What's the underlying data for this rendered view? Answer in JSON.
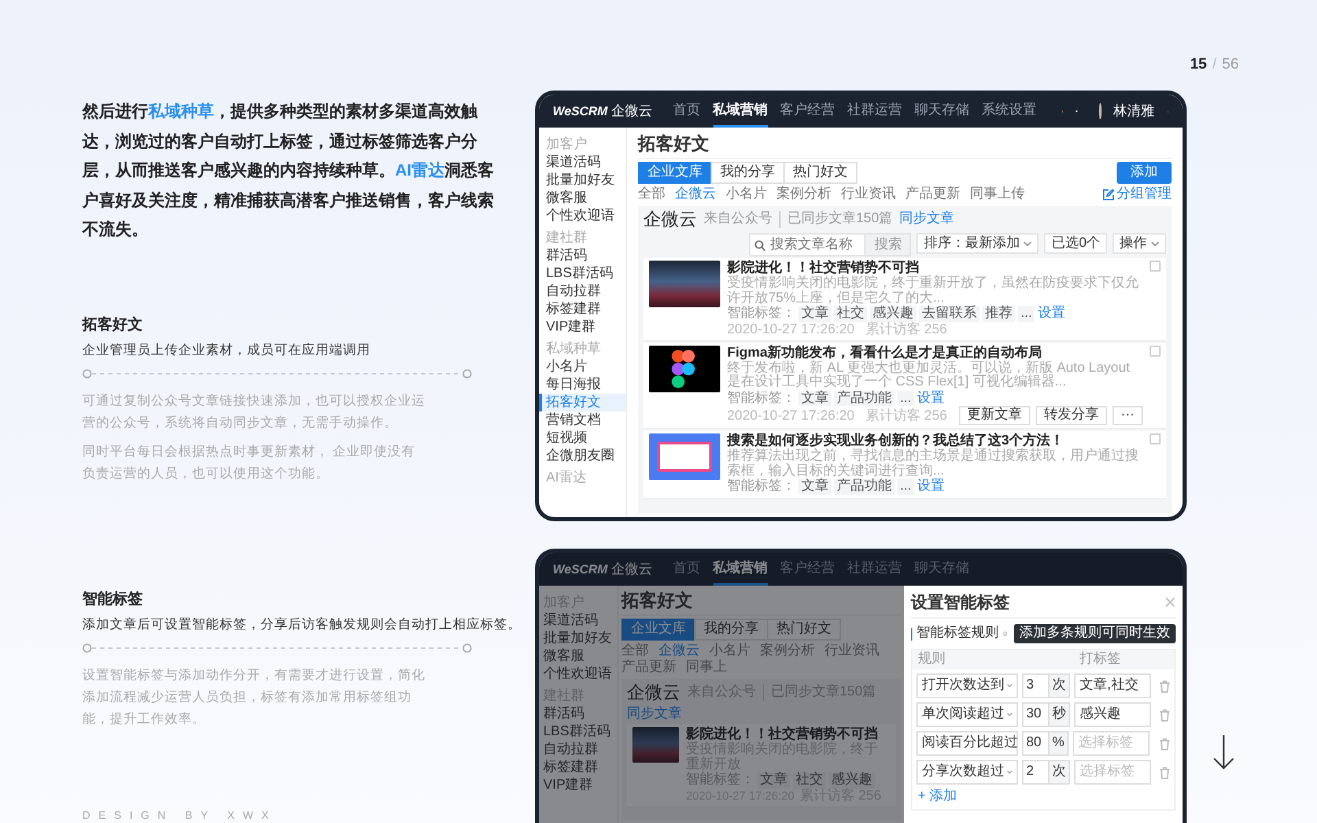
{
  "page_indicator": {
    "current": "15",
    "separator": "/",
    "total": "56"
  },
  "intro": "然后进行**私域种草**，提供多种类型的素材多渠道高效触达，浏览过的客户自动打上标签，通过标签筛选客户分层，从而推送客户感兴趣的内容持续种草。**AI雷达**洞悉客户喜好及关注度，精准捕获高潜客户推送销售，客户线索不流失。",
  "sections": [
    {
      "title": "拓客好文",
      "subtitle": "企业管理员上传企业素材，成员可在应用端调用",
      "paragraphs": [
        "可通过复制公众号文章链接快速添加，也可以授权企业运营的公众号，系统将自动同步文章，无需手动操作。",
        "同时平台每日会根据热点时事更新素材，  企业即使没有负责运营的人员，也可以使用这个功能。"
      ]
    },
    {
      "title": "智能标签",
      "subtitle": "添加文章后可设置智能标签，分享后访客触发规则会自动打上相应标签。",
      "paragraphs": [
        "设置智能标签与添加动作分开，有需要才进行设置，简化添加流程减少运营人员负担，标签有添加常用标签组功能，提升工作效率。"
      ]
    }
  ],
  "footer": "DESIGN BY XWX",
  "mockups": [
    {
      "kind": "article-list",
      "logo": {
        "brand": "WeSCRM",
        "product": "企微云"
      },
      "nav": [
        {
          "label": "首页",
          "selected": false
        },
        {
          "label": "私域营销",
          "selected": true
        },
        {
          "label": "客户经营",
          "selected": false
        },
        {
          "label": "社群运营",
          "selected": false
        },
        {
          "label": "聊天存储",
          "selected": false
        },
        {
          "label": "系统设置",
          "selected": false
        }
      ],
      "user": "林清雅",
      "sidebar": [
        {
          "title": "加客户",
          "items": [
            {
              "label": "渠道活码",
              "selected": false
            },
            {
              "label": "批量加好友",
              "selected": false
            },
            {
              "label": "微客服",
              "selected": false
            },
            {
              "label": "个性欢迎语",
              "selected": false
            }
          ]
        },
        {
          "title": "建社群",
          "items": [
            {
              "label": "群活码",
              "selected": false
            },
            {
              "label": "LBS群活码",
              "selected": false
            },
            {
              "label": "自动拉群",
              "selected": false
            },
            {
              "label": "标签建群",
              "selected": false
            },
            {
              "label": "VIP建群",
              "selected": false
            }
          ]
        },
        {
          "title": "私域种草",
          "items": [
            {
              "label": "小名片",
              "selected": false
            },
            {
              "label": "每日海报",
              "selected": false
            },
            {
              "label": "拓客好文",
              "selected": true
            },
            {
              "label": "营销文档",
              "selected": false
            },
            {
              "label": "短视频",
              "selected": false
            },
            {
              "label": "企微朋友圈",
              "selected": false
            }
          ]
        },
        {
          "title": "AI雷达"
        }
      ],
      "page_title": "拓客好文",
      "tabs": [
        {
          "label": "企业文库",
          "selected": true
        },
        {
          "label": "我的分享",
          "selected": false
        },
        {
          "label": "热门好文",
          "selected": false
        }
      ],
      "add_button": "添加",
      "filters": [
        {
          "label": "全部",
          "selected": false
        },
        {
          "label": "企微云",
          "selected": true
        },
        {
          "label": "小名片",
          "selected": false
        },
        {
          "label": "案例分析",
          "selected": false
        },
        {
          "label": "行业资讯",
          "selected": false
        },
        {
          "label": "产品更新",
          "selected": false
        },
        {
          "label": "同事上传",
          "selected": false
        }
      ],
      "group_manage": "分组管理",
      "source": {
        "name": "企微云",
        "origin": "来自公众号",
        "synced": "已同步文章150篇",
        "sync_link": "同步文章"
      },
      "search": {
        "placeholder": "搜索文章名称",
        "button": "搜索"
      },
      "sort": "排序：最新添加",
      "selected_count": "已选0个",
      "operations": "操作",
      "articles": [
        {
          "kind": "photo",
          "title": "影院进化！！社交营销势不可挡",
          "description": "受疫情影响关闭的电影院，终于重新开放了，虽然在防疫要求下仅允许开放75%上座，但是宅久了的大...",
          "tag_label": "智能标签：",
          "tags": [
            "文章",
            "社交",
            "感兴趣",
            "去留联系",
            "推荐"
          ],
          "more": "...",
          "edit_link": "设置",
          "date": "2020-10-27 17:26:20",
          "visits": "累计访客 256",
          "checked": false
        },
        {
          "kind": "logo",
          "title": "Figma新功能发布，看看什么是才是真正的自动布局",
          "description": "终于发布啦，新 AL 更强大也更加灵活。可以说，新版 Auto Layout 是在设计工具中实现了一个 CSS Flex[1] 可视化编辑器...",
          "tag_label": "智能标签：",
          "tags": [
            "文章",
            "产品功能"
          ],
          "more": "...",
          "edit_link": "设置",
          "date": "2020-10-27 17:26:20",
          "visits": "累计访客 256",
          "actions": [
            "更新文章",
            "转发分享"
          ],
          "menu_button": "···",
          "checked": false
        },
        {
          "kind": "poster",
          "title": "搜索是如何逐步实现业务创新的？我总结了这3个方法！",
          "description": "推荐算法出现之前，寻找信息的主场景是通过搜索获取，用户通过搜索框，输入目标的关键词进行查询...",
          "tag_label": "智能标签：",
          "tags": [
            "文章",
            "产品功能"
          ],
          "more": "...",
          "edit_link": "设置",
          "checked": false
        }
      ]
    },
    {
      "kind": "modal-over-list",
      "logo": {
        "brand": "WeSCRM",
        "product": "企微云"
      },
      "nav": [
        {
          "label": "首页",
          "selected": false
        },
        {
          "label": "私域营销",
          "selected": true
        },
        {
          "label": "客户经营",
          "selected": false
        },
        {
          "label": "社群运营",
          "selected": false
        },
        {
          "label": "聊天存储",
          "selected": false
        }
      ],
      "sidebar": [
        {
          "title": "加客户",
          "items": [
            {
              "label": "渠道活码",
              "selected": false
            },
            {
              "label": "批量加好友",
              "selected": false
            },
            {
              "label": "微客服",
              "selected": false
            },
            {
              "label": "个性欢迎语",
              "selected": false
            }
          ]
        },
        {
          "title": "建社群",
          "items": [
            {
              "label": "群活码",
              "selected": false
            },
            {
              "label": "LBS群活码",
              "selected": false
            },
            {
              "label": "自动拉群",
              "selected": false
            },
            {
              "label": "标签建群",
              "selected": false
            },
            {
              "label": "VIP建群",
              "selected": false
            }
          ]
        }
      ],
      "page_title": "拓客好文",
      "tabs": [
        {
          "label": "企业文库",
          "selected": true
        },
        {
          "label": "我的分享",
          "selected": false
        },
        {
          "label": "热门好文",
          "selected": false
        }
      ],
      "filters": [
        {
          "label": "全部",
          "selected": false
        },
        {
          "label": "企微云",
          "selected": true
        },
        {
          "label": "小名片",
          "selected": false
        },
        {
          "label": "案例分析",
          "selected": false
        },
        {
          "label": "行业资讯",
          "selected": false
        },
        {
          "label": "产品更新",
          "selected": false
        },
        {
          "label": "同事上",
          "selected": false
        }
      ],
      "source": {
        "name": "企微云",
        "origin": "来自公众号",
        "synced": "已同步文章150篇",
        "sync_link": "同步文章"
      },
      "articles": [
        {
          "kind": "photo",
          "title": "影院进化！！社交营销势不可挡",
          "description": "受疫情影响关闭的电影院，终于重新开放",
          "tag_label": "智能标签：",
          "tags": [
            "文章",
            "社交",
            "感兴趣"
          ],
          "date": "2020-10-27 17:26:20",
          "visits": "累计访客 256"
        }
      ],
      "modal": {
        "title": "设置智能标签",
        "section_label": "智能标签规则",
        "tooltip": "添加多条规则可同时生效",
        "columns": [
          "规则",
          "打标签"
        ],
        "rules": [
          {
            "condition": "打开次数达到",
            "value": "3",
            "unit": "次",
            "tag": "文章,社交"
          },
          {
            "condition": "单次阅读超过",
            "value": "30",
            "unit": "秒",
            "tag": "感兴趣"
          },
          {
            "condition": "阅读百分比超过",
            "value": "80",
            "unit": "%",
            "placeholder": "选择标签"
          },
          {
            "condition": "分享次数超过",
            "value": "2",
            "unit": "次",
            "placeholder": "选择标签"
          }
        ],
        "add_link": "+ 添加"
      }
    }
  ]
}
